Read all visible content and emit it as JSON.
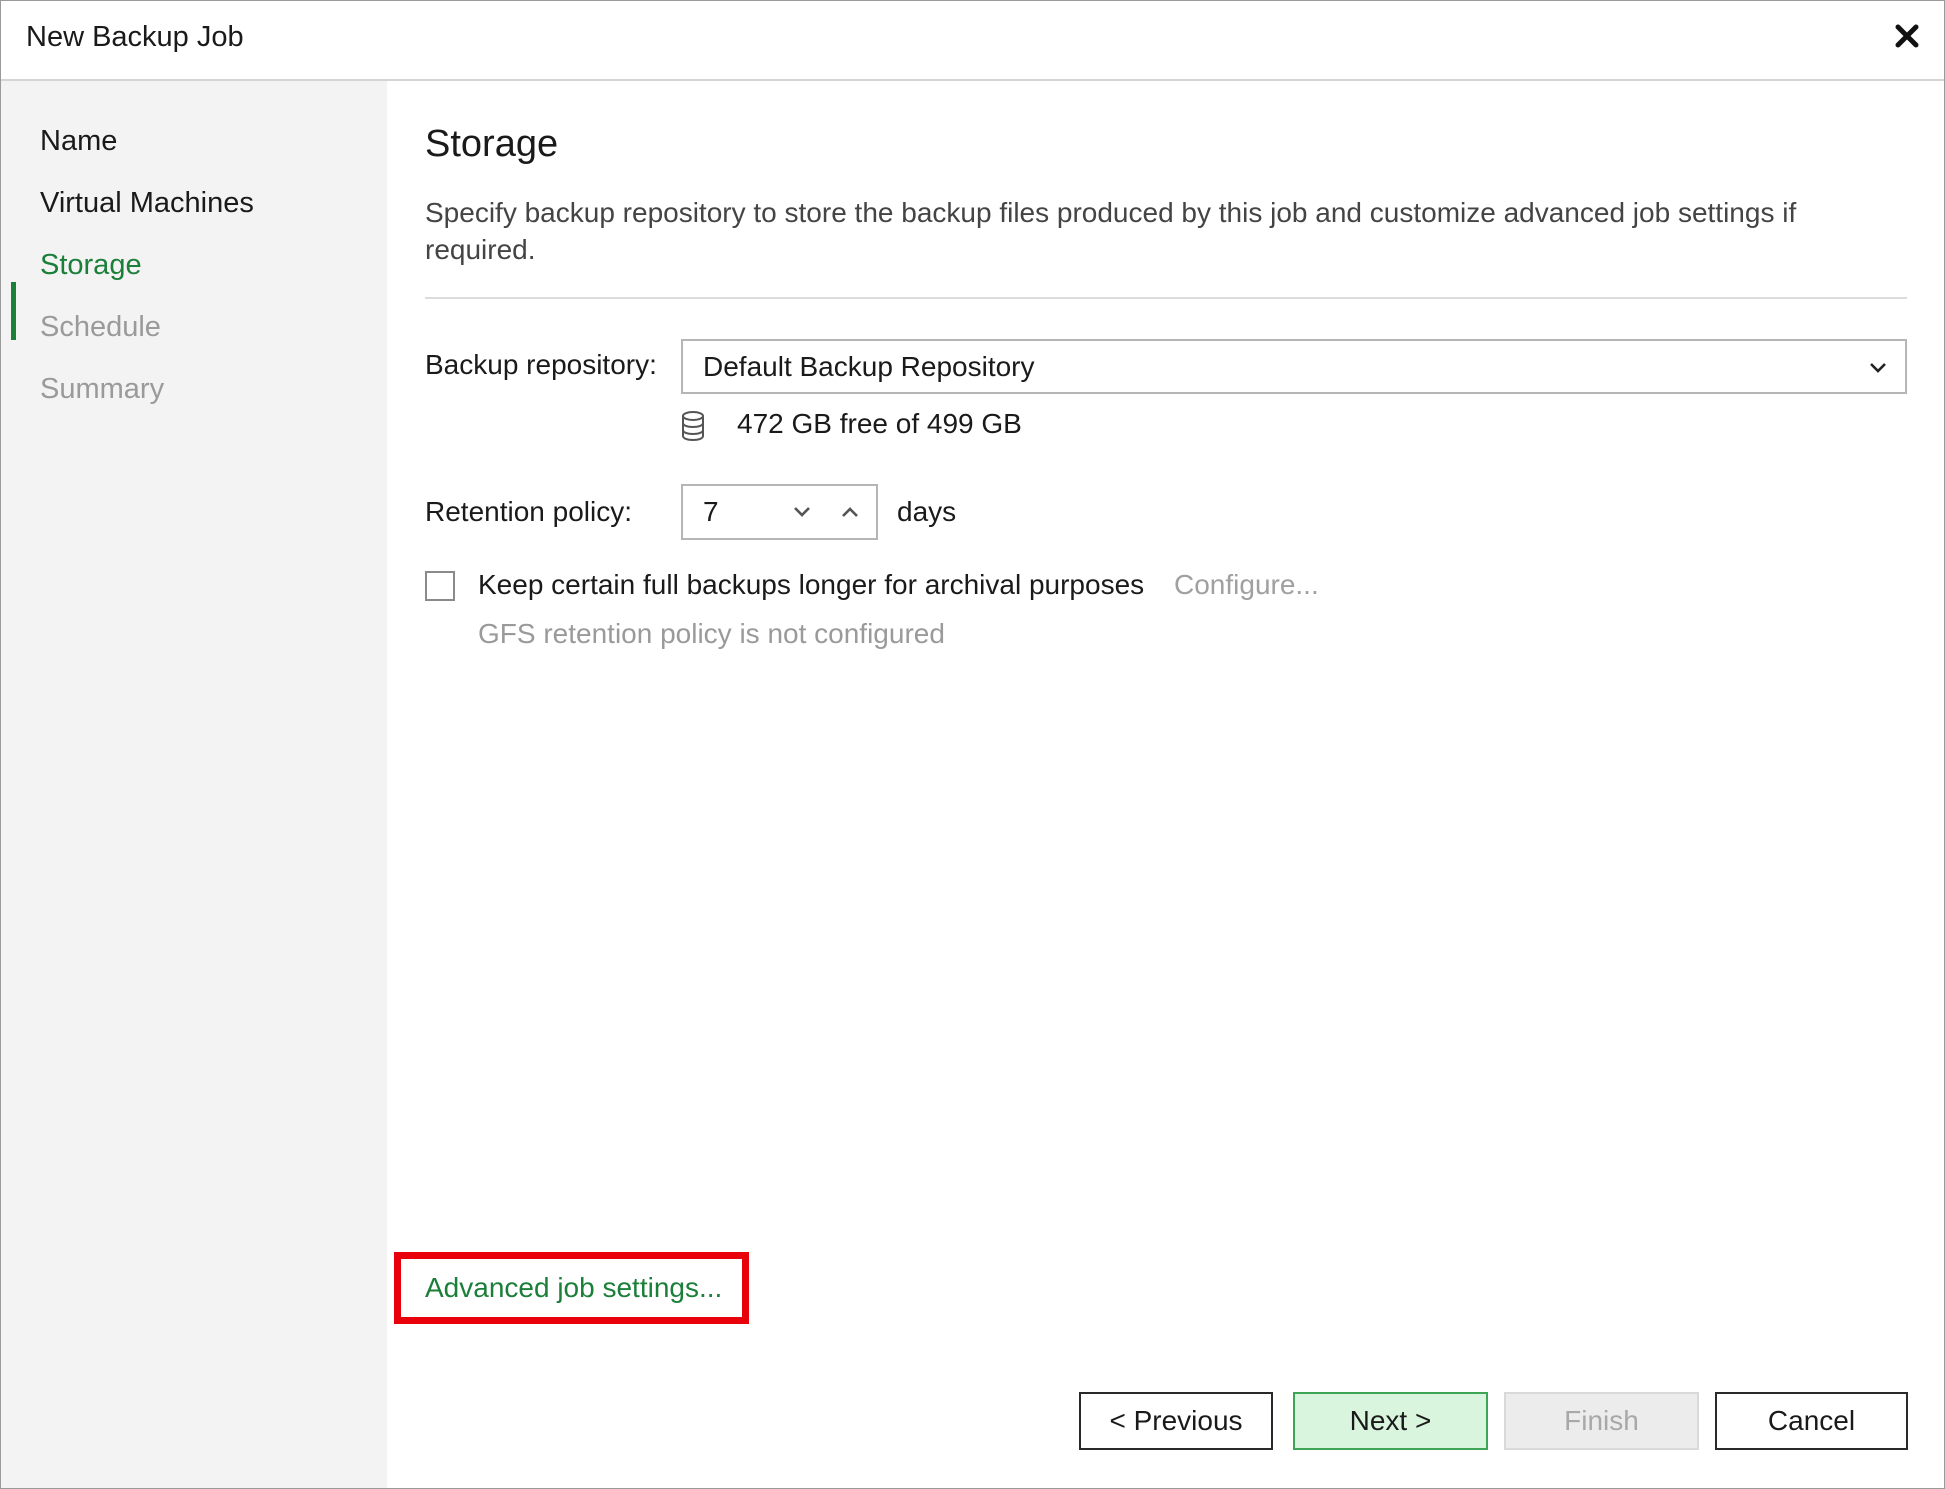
{
  "window": {
    "title": "New Backup Job",
    "close_icon": "close-icon"
  },
  "nav": {
    "items": [
      {
        "label": "Name",
        "state": "done"
      },
      {
        "label": "Virtual Machines",
        "state": "done"
      },
      {
        "label": "Storage",
        "state": "active"
      },
      {
        "label": "Schedule",
        "state": "pending"
      },
      {
        "label": "Summary",
        "state": "pending"
      }
    ]
  },
  "page": {
    "title": "Storage",
    "description": "Specify backup repository to store the backup files produced by this job and customize advanced job settings if required."
  },
  "repository": {
    "label": "Backup repository:",
    "selected": "Default Backup Repository",
    "free_space": "472 GB free of 499 GB",
    "icon": "database-icon"
  },
  "retention": {
    "label": "Retention policy:",
    "value": "7",
    "unit": "days"
  },
  "gfs": {
    "checkbox_label": "Keep certain full backups longer for archival purposes",
    "checked": false,
    "configure_label": "Configure...",
    "status": "GFS retention policy is not configured"
  },
  "advanced": {
    "link_label": "Advanced job settings..."
  },
  "buttons": {
    "previous": "< Previous",
    "next": "Next >",
    "finish": "Finish",
    "cancel": "Cancel"
  },
  "colors": {
    "accent": "#1b7f3a",
    "highlight": "#e8000b",
    "next_bg": "#d9f5dd"
  }
}
